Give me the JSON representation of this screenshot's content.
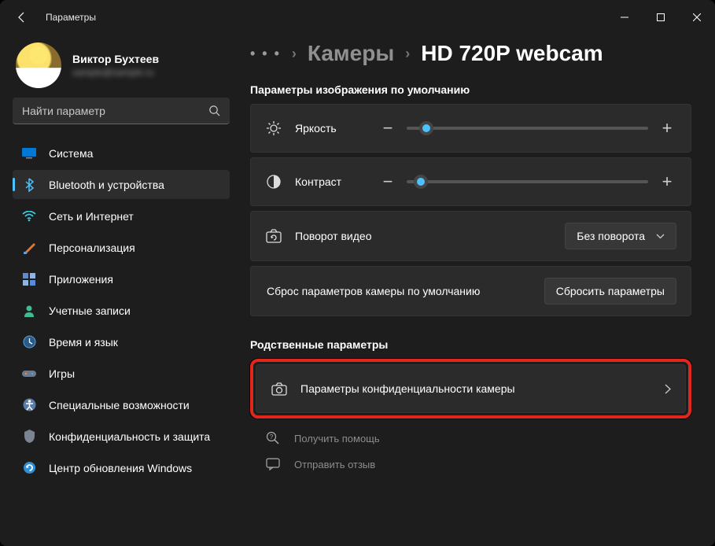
{
  "window": {
    "title": "Параметры"
  },
  "user": {
    "name": "Виктор Бухтеев",
    "email": "sample@sample.ru"
  },
  "search": {
    "placeholder": "Найти параметр"
  },
  "nav": {
    "items": [
      {
        "label": "Система"
      },
      {
        "label": "Bluetooth и устройства"
      },
      {
        "label": "Сеть и Интернет"
      },
      {
        "label": "Персонализация"
      },
      {
        "label": "Приложения"
      },
      {
        "label": "Учетные записи"
      },
      {
        "label": "Время и язык"
      },
      {
        "label": "Игры"
      },
      {
        "label": "Специальные возможности"
      },
      {
        "label": "Конфиденциальность и защита"
      },
      {
        "label": "Центр обновления Windows"
      }
    ],
    "activeIndex": 1
  },
  "breadcrumb": {
    "parent": "Камеры",
    "current": "HD 720P webcam"
  },
  "defaults": {
    "section_title": "Параметры изображения по умолчанию",
    "brightness": {
      "label": "Яркость",
      "value": 8
    },
    "contrast": {
      "label": "Контраст",
      "value": 6
    },
    "rotation": {
      "label": "Поворот видео",
      "selected": "Без поворота"
    },
    "reset": {
      "label": "Сброс параметров камеры по умолчанию",
      "button": "Сбросить параметры"
    }
  },
  "related": {
    "section_title": "Родственные параметры",
    "privacy": {
      "label": "Параметры конфиденциальности камеры"
    }
  },
  "help": {
    "get_help": "Получить помощь",
    "feedback": "Отправить отзыв"
  }
}
